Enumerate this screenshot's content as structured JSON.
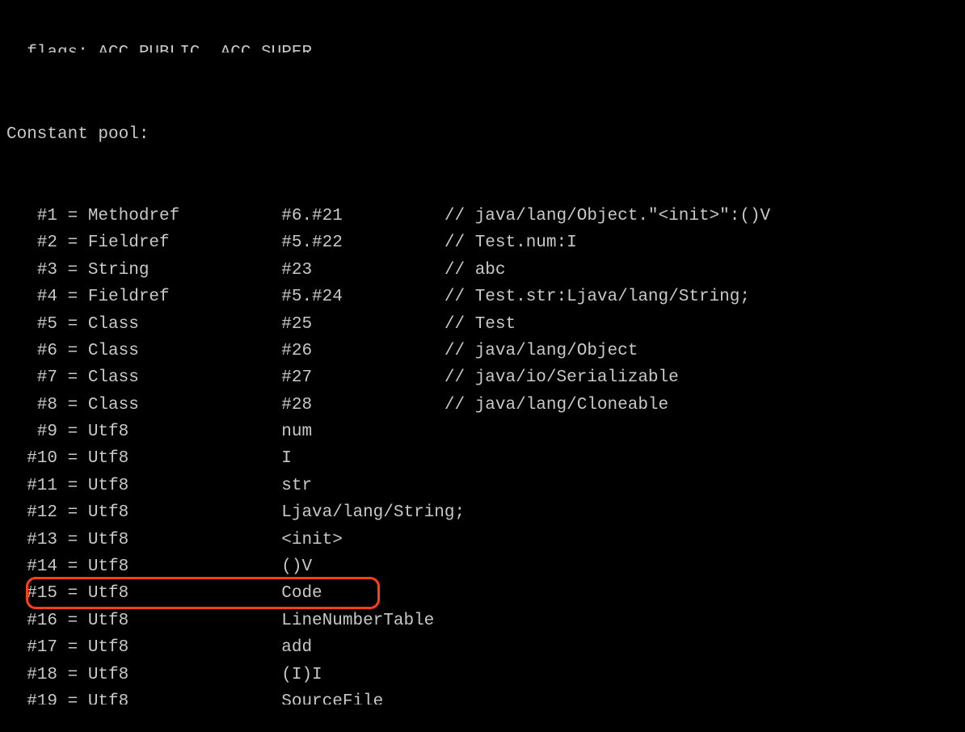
{
  "header": {
    "flags_partial": "  flags: ACC_PUBLIC, ACC_SUPER",
    "title": "Constant pool:"
  },
  "pool": [
    {
      "idx": "   #1",
      "eq": " = ",
      "type": "Methodref",
      "pad1": "          ",
      "ref": "#6.#21",
      "pad2": "         ",
      "comment": "// java/lang/Object.\"<init>\":()V"
    },
    {
      "idx": "   #2",
      "eq": " = ",
      "type": "Fieldref",
      "pad1": "           ",
      "ref": "#5.#22",
      "pad2": "         ",
      "comment": "// Test.num:I"
    },
    {
      "idx": "   #3",
      "eq": " = ",
      "type": "String",
      "pad1": "             ",
      "ref": "#23",
      "pad2": "            ",
      "comment": "// abc"
    },
    {
      "idx": "   #4",
      "eq": " = ",
      "type": "Fieldref",
      "pad1": "           ",
      "ref": "#5.#24",
      "pad2": "         ",
      "comment": "// Test.str:Ljava/lang/String;"
    },
    {
      "idx": "   #5",
      "eq": " = ",
      "type": "Class",
      "pad1": "              ",
      "ref": "#25",
      "pad2": "            ",
      "comment": "// Test"
    },
    {
      "idx": "   #6",
      "eq": " = ",
      "type": "Class",
      "pad1": "              ",
      "ref": "#26",
      "pad2": "            ",
      "comment": "// java/lang/Object"
    },
    {
      "idx": "   #7",
      "eq": " = ",
      "type": "Class",
      "pad1": "              ",
      "ref": "#27",
      "pad2": "            ",
      "comment": "// java/io/Serializable"
    },
    {
      "idx": "   #8",
      "eq": " = ",
      "type": "Class",
      "pad1": "              ",
      "ref": "#28",
      "pad2": "            ",
      "comment": "// java/lang/Cloneable"
    },
    {
      "idx": "   #9",
      "eq": " = ",
      "type": "Utf8",
      "pad1": "               ",
      "ref": "num",
      "pad2": "",
      "comment": ""
    },
    {
      "idx": "  #10",
      "eq": " = ",
      "type": "Utf8",
      "pad1": "               ",
      "ref": "I",
      "pad2": "",
      "comment": ""
    },
    {
      "idx": "  #11",
      "eq": " = ",
      "type": "Utf8",
      "pad1": "               ",
      "ref": "str",
      "pad2": "",
      "comment": ""
    },
    {
      "idx": "  #12",
      "eq": " = ",
      "type": "Utf8",
      "pad1": "               ",
      "ref": "Ljava/lang/String;",
      "pad2": "",
      "comment": ""
    },
    {
      "idx": "  #13",
      "eq": " = ",
      "type": "Utf8",
      "pad1": "               ",
      "ref": "<init>",
      "pad2": "",
      "comment": ""
    },
    {
      "idx": "  #14",
      "eq": " = ",
      "type": "Utf8",
      "pad1": "               ",
      "ref": "()V",
      "pad2": "",
      "comment": ""
    },
    {
      "idx": "  #15",
      "eq": " = ",
      "type": "Utf8",
      "pad1": "               ",
      "ref": "Code",
      "pad2": "",
      "comment": "",
      "highlight": true
    },
    {
      "idx": "  #16",
      "eq": " = ",
      "type": "Utf8",
      "pad1": "               ",
      "ref": "LineNumberTable",
      "pad2": "",
      "comment": ""
    },
    {
      "idx": "  #17",
      "eq": " = ",
      "type": "Utf8",
      "pad1": "               ",
      "ref": "add",
      "pad2": "",
      "comment": ""
    },
    {
      "idx": "  #18",
      "eq": " = ",
      "type": "Utf8",
      "pad1": "               ",
      "ref": "(I)I",
      "pad2": "",
      "comment": ""
    },
    {
      "idx": "  #19",
      "eq": " = ",
      "type": "Utf8",
      "pad1": "               ",
      "ref": "SourceFile",
      "pad2": "",
      "comment": ""
    }
  ]
}
